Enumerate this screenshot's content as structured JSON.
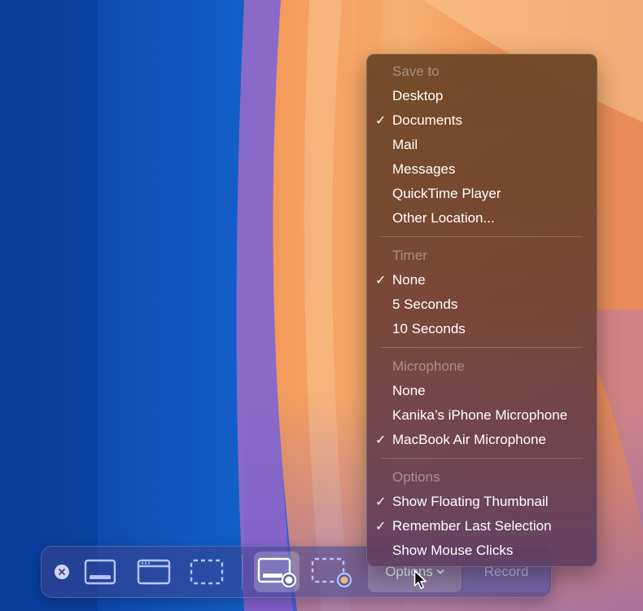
{
  "toolbar": {
    "options_label": "Options",
    "record_label": "Record",
    "tools": [
      {
        "name": "capture-entire-screen",
        "selected": false
      },
      {
        "name": "capture-window",
        "selected": false
      },
      {
        "name": "capture-selection",
        "selected": false
      },
      {
        "name": "record-entire-screen",
        "selected": true
      },
      {
        "name": "record-selection",
        "selected": false
      }
    ]
  },
  "menu": {
    "save_to": {
      "header": "Save to",
      "items": [
        {
          "label": "Desktop",
          "checked": false
        },
        {
          "label": "Documents",
          "checked": true
        },
        {
          "label": "Mail",
          "checked": false
        },
        {
          "label": "Messages",
          "checked": false
        },
        {
          "label": "QuickTime Player",
          "checked": false
        },
        {
          "label": "Other Location...",
          "checked": false
        }
      ]
    },
    "timer": {
      "header": "Timer",
      "items": [
        {
          "label": "None",
          "checked": true
        },
        {
          "label": "5 Seconds",
          "checked": false
        },
        {
          "label": "10 Seconds",
          "checked": false
        }
      ]
    },
    "microphone": {
      "header": "Microphone",
      "items": [
        {
          "label": "None",
          "checked": false
        },
        {
          "label": "Kanika’s iPhone Microphone",
          "checked": false
        },
        {
          "label": "MacBook Air Microphone",
          "checked": true
        }
      ]
    },
    "options": {
      "header": "Options",
      "items": [
        {
          "label": "Show Floating Thumbnail",
          "checked": true
        },
        {
          "label": "Remember Last Selection",
          "checked": true
        },
        {
          "label": "Show Mouse Clicks",
          "checked": false
        }
      ]
    },
    "check_glyph": "✓"
  },
  "colors": {
    "accent": "#aab8ff",
    "menu_text": "#ffffff"
  }
}
